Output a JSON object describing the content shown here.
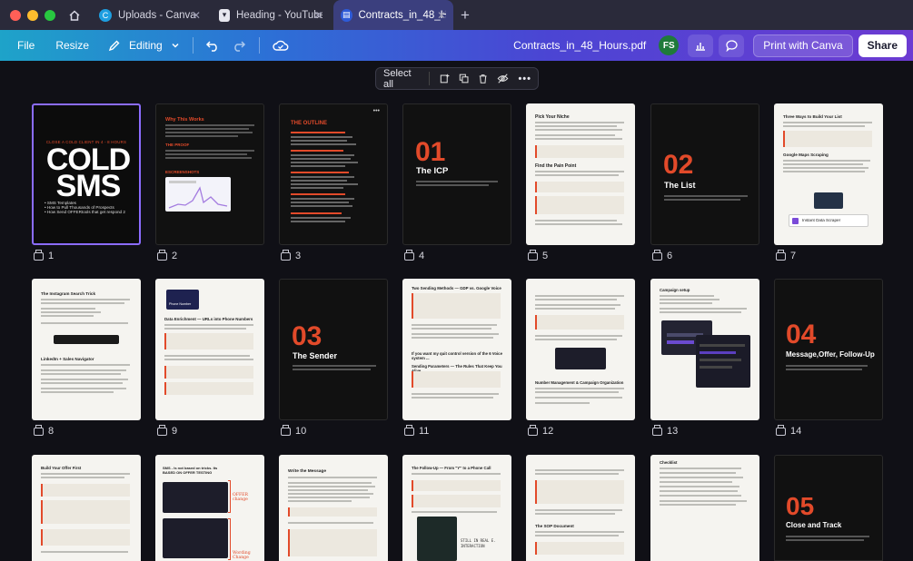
{
  "browser": {
    "tabs": [
      {
        "label": "Uploads - Canva",
        "icon": "C",
        "color": "#1e9ee0"
      },
      {
        "label": "Heading - YouTube ...",
        "icon": "▾",
        "color": "#e7e7ef"
      },
      {
        "label": "Contracts_in_48_H...",
        "icon": "▤",
        "color": "#2e5bd8"
      }
    ],
    "window_colors": [
      "#ff5f57",
      "#febc2e",
      "#28c840"
    ]
  },
  "toolbar": {
    "file": "File",
    "resize": "Resize",
    "editing": "Editing",
    "doc_title": "Contracts_in_48_Hours.pdf",
    "avatar": "FS",
    "print": "Print with Canva",
    "share": "Share"
  },
  "selection_toolbar": {
    "select_all": "Select all"
  },
  "pages": [
    {
      "n": "1",
      "theme": "dark",
      "selected": true
    },
    {
      "n": "2",
      "theme": "dark"
    },
    {
      "n": "3",
      "theme": "dark"
    },
    {
      "n": "4",
      "theme": "dark",
      "big": "01",
      "title": "The ICP"
    },
    {
      "n": "5",
      "theme": "light"
    },
    {
      "n": "6",
      "theme": "dark",
      "big": "02",
      "title": "The List"
    },
    {
      "n": "7",
      "theme": "light"
    },
    {
      "n": "8",
      "theme": "light"
    },
    {
      "n": "9",
      "theme": "light"
    },
    {
      "n": "10",
      "theme": "dark",
      "big": "03",
      "title": "The Sender"
    },
    {
      "n": "11",
      "theme": "light"
    },
    {
      "n": "12",
      "theme": "light"
    },
    {
      "n": "13",
      "theme": "light"
    },
    {
      "n": "14",
      "theme": "dark",
      "big": "04",
      "title": "Message,Offer, Follow-Up"
    },
    {
      "n": "",
      "theme": "light"
    },
    {
      "n": "",
      "theme": "light"
    },
    {
      "n": "",
      "theme": "light"
    },
    {
      "n": "",
      "theme": "light"
    },
    {
      "n": "",
      "theme": "light"
    },
    {
      "n": "",
      "theme": "light"
    },
    {
      "n": "",
      "theme": "dark",
      "big": "05",
      "title": "Close and Track"
    }
  ],
  "page1": {
    "kicker": "CLOSE A COLD CLIENT IN 4 - 8 HOURS",
    "big1": "COLD",
    "big2": "SMS",
    "bullets": [
      "• SMS Templates",
      "• How to Pull Thousands of Prospects",
      "• How Send OFFERtools that get respond 2"
    ]
  },
  "page2": {
    "head": "Why This Works",
    "sub": "THE PROOF",
    "sub2": "ESCREENSHOTS"
  },
  "page3": {
    "head": "THE OUTLINE",
    "more": "•••"
  },
  "page5": {
    "h1": "Pick Your Niche",
    "h2": "Find the Pain Point"
  },
  "page7": {
    "h1": "Three Ways to Build Your List",
    "h2": "Google Maps Scraping",
    "card": "Instant Data Scraper"
  },
  "page8": {
    "h1": "The Instagram Search Trick",
    "h2": "LinkedIn + Sales Navigator"
  },
  "page9": {
    "head": "Data Enrichment — URLs into Phone Numbers",
    "card": "Phone Number"
  },
  "page11": {
    "h1": "Two Sending Methods — GDP vs. Google Voice",
    "q": "If you want my quit control version of the 6 Voice system ...",
    "h2": "Sending Parameters — The Rules That Keep You Alive"
  },
  "page12": {
    "h1": "Number Management & Campaign Organization"
  },
  "page13": {
    "h1": "Campaign setup"
  },
  "page15": {
    "h1": "Build Your Offer First"
  },
  "page16": {
    "h1": "SMS - Is not based on tricks. Its BASED ON OFFER TESTING",
    "note1": "OFFER change",
    "note2": "Wording Change"
  },
  "page17": {
    "h1": "Write the Message"
  },
  "page18": {
    "h1": "The Follow-Up — From \"Y\" to a Phone Call",
    "img": "STILL IN REAL E. INTERACTION"
  },
  "page19": {
    "h1": "The SOP Document"
  },
  "page20": {
    "h1": "Checklist"
  }
}
